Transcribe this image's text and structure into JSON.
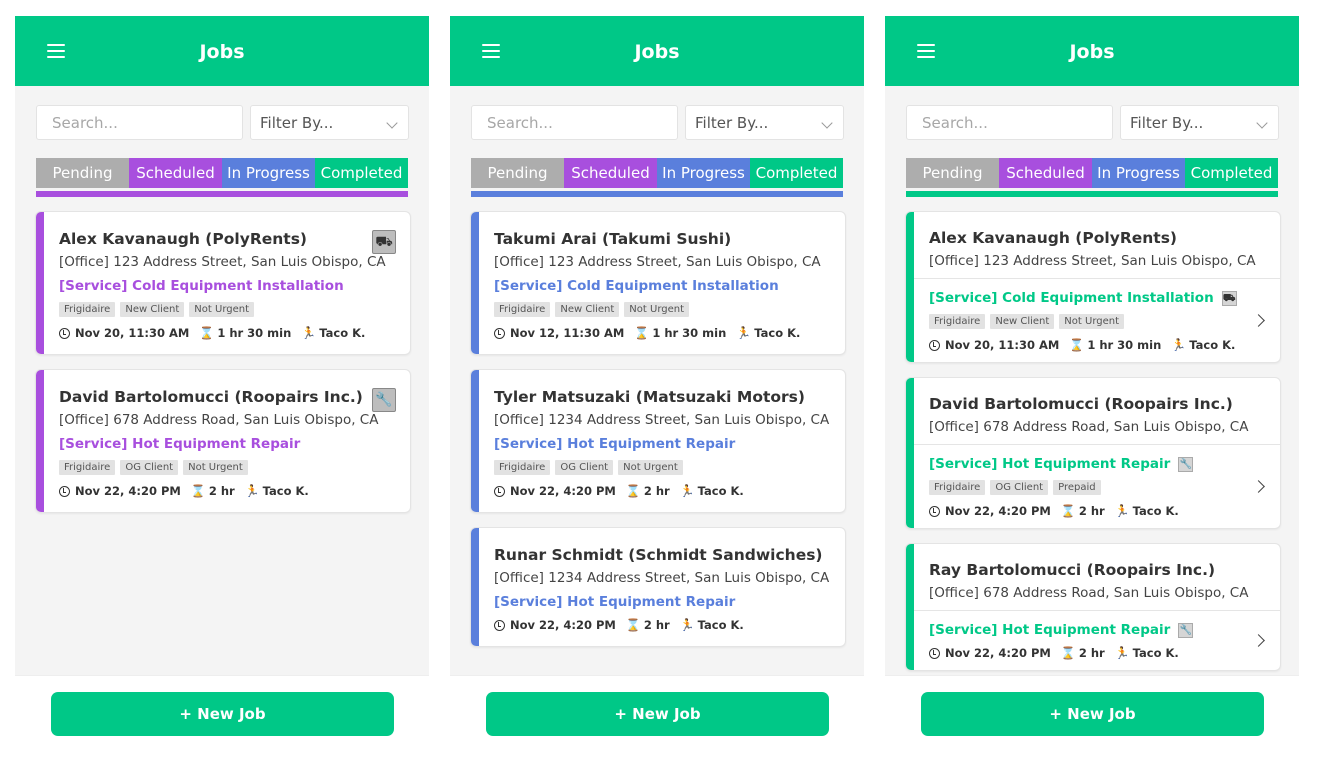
{
  "colors": {
    "accent": "#00c887",
    "pending": "#adadad",
    "scheduled": "#a84fde",
    "in_progress": "#5a7fdc",
    "completed": "#00c887"
  },
  "screens": [
    {
      "title": "Jobs",
      "search_placeholder": "Search...",
      "filter_label": "Filter By...",
      "tabs": [
        "Pending",
        "Scheduled",
        "In Progress",
        "Completed"
      ],
      "active_tab": "Scheduled",
      "new_job": "+ New Job",
      "jobs": [
        {
          "name": "Alex Kavanaugh (PolyRents)",
          "address": "[Office] 123 Address Street, San Luis Obispo, CA",
          "service": "[Service] Cold Equipment Installation",
          "icon": "dolly-icon",
          "tags": [
            "Frigidaire",
            "New Client",
            "Not Urgent"
          ],
          "date": "Nov 20, 11:30 AM",
          "duration": "1 hr 30 min",
          "tech": "Taco K."
        },
        {
          "name": "David Bartolomucci (Roopairs Inc.)",
          "address": "[Office] 678 Address Road, San Luis Obispo, CA",
          "service": "[Service] Hot Equipment Repair",
          "icon": "wrench-icon",
          "tags": [
            "Frigidaire",
            "OG Client",
            "Not Urgent"
          ],
          "date": "Nov 22, 4:20 PM",
          "duration": "2 hr",
          "tech": "Taco K."
        }
      ]
    },
    {
      "title": "Jobs",
      "search_placeholder": "Search...",
      "filter_label": "Filter By...",
      "tabs": [
        "Pending",
        "Scheduled",
        "In Progress",
        "Completed"
      ],
      "active_tab": "In Progress",
      "new_job": "+ New Job",
      "jobs": [
        {
          "name": "Takumi Arai (Takumi Sushi)",
          "address": "[Office] 123 Address Street, San Luis Obispo, CA",
          "service": "[Service] Cold Equipment Installation",
          "tags": [
            "Frigidaire",
            "New Client",
            "Not Urgent"
          ],
          "date": "Nov 12, 11:30 AM",
          "duration": "1 hr 30 min",
          "tech": "Taco K."
        },
        {
          "name": "Tyler Matsuzaki (Matsuzaki Motors)",
          "address": "[Office] 1234 Address Street, San Luis Obispo, CA",
          "service": "[Service] Hot Equipment Repair",
          "tags": [
            "Frigidaire",
            "OG Client",
            "Not Urgent"
          ],
          "date": "Nov 22, 4:20 PM",
          "duration": "2 hr",
          "tech": "Taco K."
        },
        {
          "name": "Runar Schmidt (Schmidt Sandwiches)",
          "address": "[Office] 1234 Address Street, San Luis Obispo, CA",
          "service": "[Service] Hot Equipment Repair",
          "tags": [],
          "date": "Nov 22, 4:20 PM",
          "duration": "2 hr",
          "tech": "Taco K."
        }
      ]
    },
    {
      "title": "Jobs",
      "search_placeholder": "Search...",
      "filter_label": "Filter By...",
      "tabs": [
        "Pending",
        "Scheduled",
        "In Progress",
        "Completed"
      ],
      "active_tab": "Completed",
      "new_job": "+ New Job",
      "jobs": [
        {
          "name": "Alex Kavanaugh (PolyRents)",
          "address": "[Office] 123 Address Street, San Luis Obispo, CA",
          "service": "[Service] Cold Equipment Installation",
          "icon": "dolly-icon",
          "tags": [
            "Frigidaire",
            "New Client",
            "Not Urgent"
          ],
          "date": "Nov 20, 11:30 AM",
          "duration": "1 hr 30 min",
          "tech": "Taco K."
        },
        {
          "name": "David Bartolomucci (Roopairs Inc.)",
          "address": "[Office] 678 Address Road, San Luis Obispo, CA",
          "service": "[Service] Hot Equipment Repair",
          "icon": "wrench-icon",
          "tags": [
            "Frigidaire",
            "OG Client",
            "Prepaid"
          ],
          "date": "Nov 22, 4:20 PM",
          "duration": "2 hr",
          "tech": "Taco K."
        },
        {
          "name": "Ray Bartolomucci (Roopairs Inc.)",
          "address": "[Office] 678 Address Road, San Luis Obispo, CA",
          "service": "[Service] Hot Equipment Repair",
          "icon": "wrench-icon",
          "tags": [],
          "date": "Nov 22, 4:20 PM",
          "duration": "2 hr",
          "tech": "Taco K."
        }
      ]
    }
  ]
}
